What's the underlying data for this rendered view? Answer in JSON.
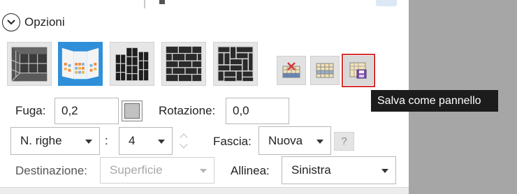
{
  "section": {
    "label": "Opzioni",
    "toggle_icon": "chevron-down-icon"
  },
  "patterns": [
    {
      "name": "grid-corner-pattern",
      "icon": "corner-grid-icon"
    },
    {
      "name": "tiled-panels-pattern",
      "icon": "tiled-panels-icon",
      "selected": true
    },
    {
      "name": "vertical-strips-pattern",
      "icon": "vertical-strips-icon"
    },
    {
      "name": "brick-pattern",
      "icon": "brick-pattern-icon"
    },
    {
      "name": "basketweave-pattern",
      "icon": "basketweave-icon"
    }
  ],
  "actions": {
    "delete_icon": "delete-panel-icon",
    "panel_icon": "panel-icon",
    "save_icon": "save-panel-icon",
    "tooltip": "Salva come pannello"
  },
  "fields": {
    "fuga_label": "Fuga:",
    "fuga_value": "0,2",
    "fuga_color": "#c2c2c2",
    "rotazione_label": "Rotazione:",
    "rotazione_value": "0,0",
    "righe_select": "N. righe",
    "colon": ":",
    "righe_value": "4",
    "fascia_label": "Fascia:",
    "fascia_value": "Nuova",
    "help": "?",
    "destinazione_label": "Destinazione:",
    "destinazione_value": "Superficie",
    "allinea_label": "Allinea:",
    "allinea_value": "Sinistra"
  },
  "colors": {
    "selected": "#2f90d9",
    "highlight": "#d32f2f",
    "right_panel": "#a6a6a6"
  }
}
